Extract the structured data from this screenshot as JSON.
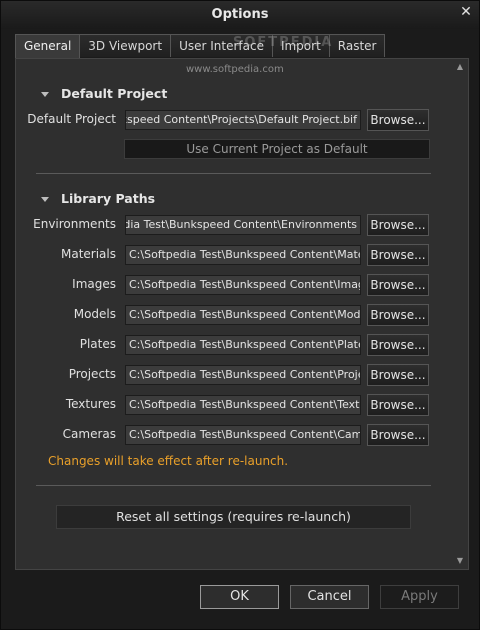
{
  "window": {
    "title": "Options",
    "close_glyph": "✕"
  },
  "tabs": [
    {
      "label": "General",
      "active": true
    },
    {
      "label": "3D Viewport",
      "active": false
    },
    {
      "label": "User Interface",
      "active": false
    },
    {
      "label": "Import",
      "active": false
    },
    {
      "label": "Raster",
      "active": false
    }
  ],
  "watermark": {
    "url": "www.softpedia.com",
    "brand": "SOFTPEDIA"
  },
  "default_project": {
    "header": "Default Project",
    "label": "Default Project",
    "value": "C:\\Softpedia Test\\Bunkspeed Content\\Projects\\Default Project.bif",
    "browse_label": "Browse...",
    "use_current_label": "Use Current Project as Default"
  },
  "library_paths": {
    "header": "Library Paths",
    "browse_label": "Browse...",
    "rows": [
      {
        "label": "Environments",
        "value": "C:\\Softpedia Test\\Bunkspeed Content\\Environments"
      },
      {
        "label": "Materials",
        "value": "C:\\Softpedia Test\\Bunkspeed Content\\Materials"
      },
      {
        "label": "Images",
        "value": "C:\\Softpedia Test\\Bunkspeed Content\\Images"
      },
      {
        "label": "Models",
        "value": "C:\\Softpedia Test\\Bunkspeed Content\\Models"
      },
      {
        "label": "Plates",
        "value": "C:\\Softpedia Test\\Bunkspeed Content\\Plates"
      },
      {
        "label": "Projects",
        "value": "C:\\Softpedia Test\\Bunkspeed Content\\Projects"
      },
      {
        "label": "Textures",
        "value": "C:\\Softpedia Test\\Bunkspeed Content\\Textures"
      },
      {
        "label": "Cameras",
        "value": "C:\\Softpedia Test\\Bunkspeed Content\\Cameras"
      }
    ]
  },
  "notice": "Changes will take effect after re-launch.",
  "reset_label": "Reset all settings (requires re-launch)",
  "buttons": {
    "ok": "OK",
    "cancel": "Cancel",
    "apply": "Apply"
  },
  "colors": {
    "notice": "#e9a02a",
    "panel": "#2f2f2f",
    "background": "#1b1b1b"
  }
}
